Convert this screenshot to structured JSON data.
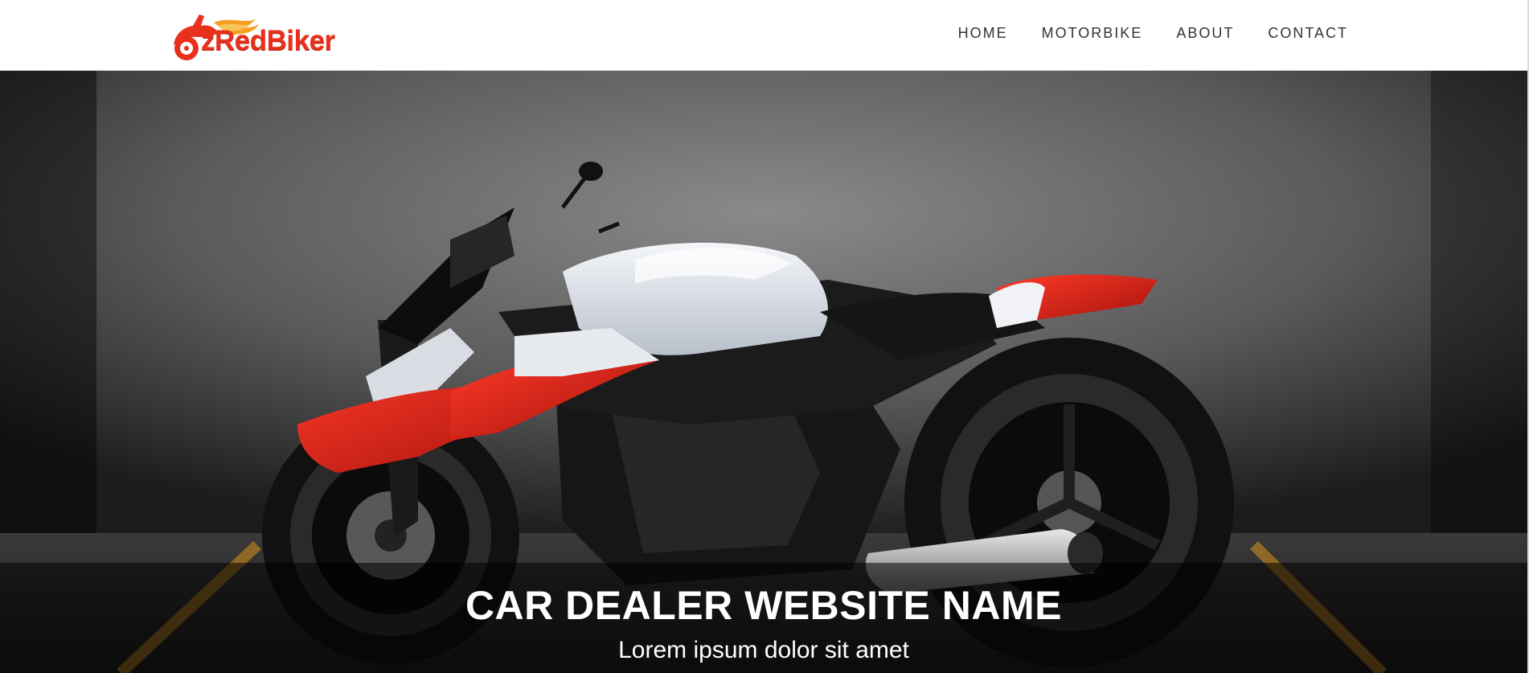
{
  "brand": {
    "name": "zRedBiker",
    "colors": {
      "primary": "#e8311c",
      "flame": "#f5a020"
    }
  },
  "nav": {
    "items": [
      {
        "label": "HOME"
      },
      {
        "label": "MOTORBIKE"
      },
      {
        "label": "ABOUT"
      },
      {
        "label": "CONTACT"
      }
    ]
  },
  "hero": {
    "image": "motorcycle-photo",
    "title": "CAR DEALER WEBSITE NAME",
    "subtitle": "Lorem ipsum dolor sit amet"
  }
}
